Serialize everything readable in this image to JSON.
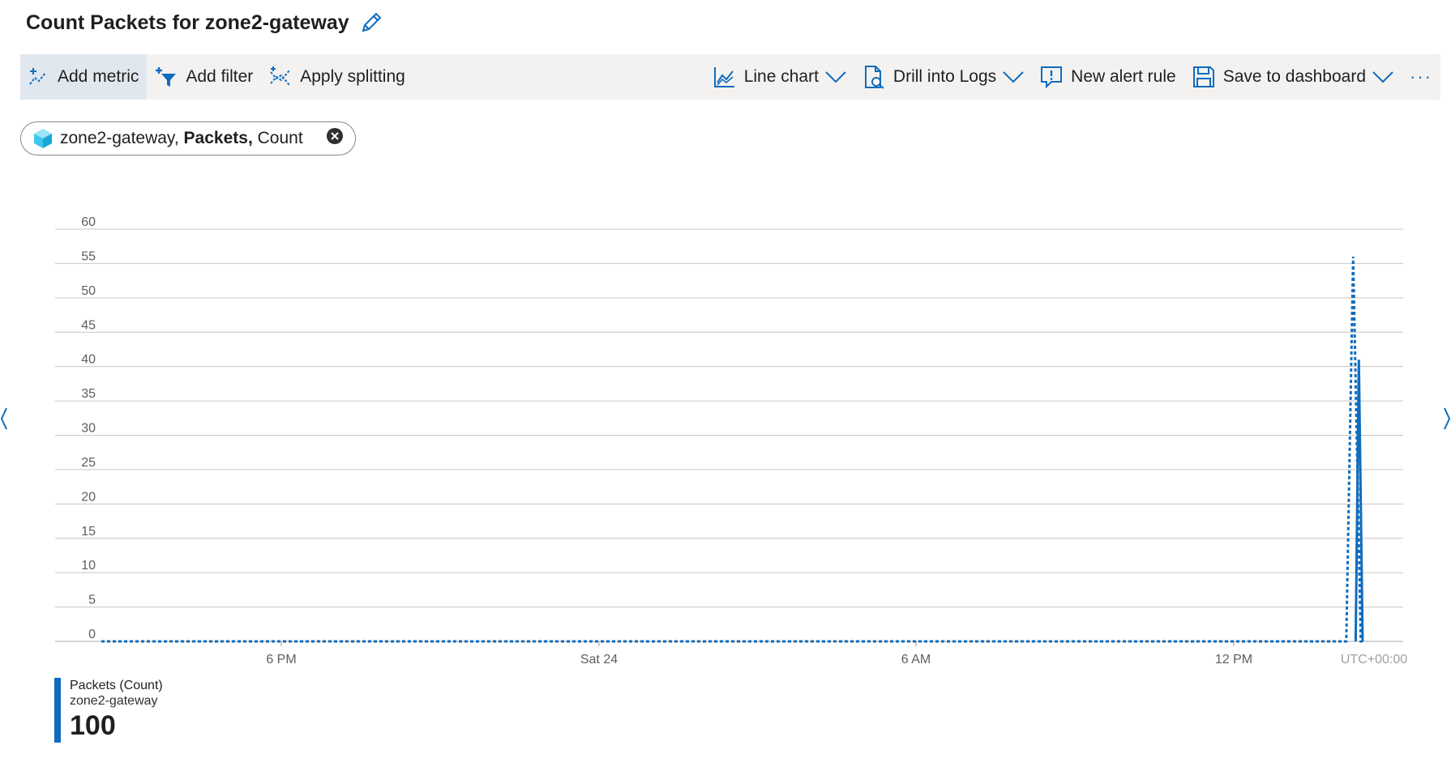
{
  "header": {
    "title": "Count Packets for zone2-gateway",
    "edit_icon": "pencil-icon"
  },
  "toolbar": {
    "add_metric": "Add metric",
    "add_filter": "Add filter",
    "apply_splitting": "Apply splitting",
    "chart_type": "Line chart",
    "drill_logs": "Drill into Logs",
    "new_alert": "New alert rule",
    "save_dashboard": "Save to dashboard",
    "more": "···"
  },
  "metric_pill": {
    "resource": "zone2-gateway,",
    "metric": "Packets,",
    "aggregation": "Count"
  },
  "colors": {
    "accent": "#0f6cbd",
    "toolbar_bg": "#f3f2f1",
    "grid": "#c8c6c4"
  },
  "chart_data": {
    "type": "line",
    "y_ticks": [
      "0",
      "5",
      "10",
      "15",
      "20",
      "25",
      "30",
      "35",
      "40",
      "45",
      "50",
      "55",
      "60"
    ],
    "ylim": [
      0,
      60
    ],
    "x_tick_labels": [
      "6 PM",
      "Sat 24",
      "6 AM",
      "12 PM"
    ],
    "timezone_label": "UTC+00:00",
    "series": [
      {
        "style": "dashed",
        "points": [
          [
            0.0,
            0
          ],
          [
            0.04,
            0
          ],
          [
            0.1,
            0
          ],
          [
            0.2,
            0
          ],
          [
            0.3,
            0
          ],
          [
            0.4,
            0
          ],
          [
            0.5,
            0
          ],
          [
            0.6,
            0
          ],
          [
            0.7,
            0
          ],
          [
            0.8,
            0
          ],
          [
            0.9,
            0
          ],
          [
            0.95,
            0
          ],
          [
            0.987,
            0
          ],
          [
            0.9925,
            56
          ],
          [
            0.9985,
            0
          ],
          [
            1.0,
            0
          ]
        ]
      },
      {
        "style": "solid",
        "points": [
          [
            0.9945,
            0
          ],
          [
            0.997,
            41
          ],
          [
            1.0,
            0
          ]
        ]
      }
    ],
    "grid": true
  },
  "legend": {
    "title": "Packets (Count)",
    "subtitle": "zone2-gateway",
    "value": "100"
  }
}
